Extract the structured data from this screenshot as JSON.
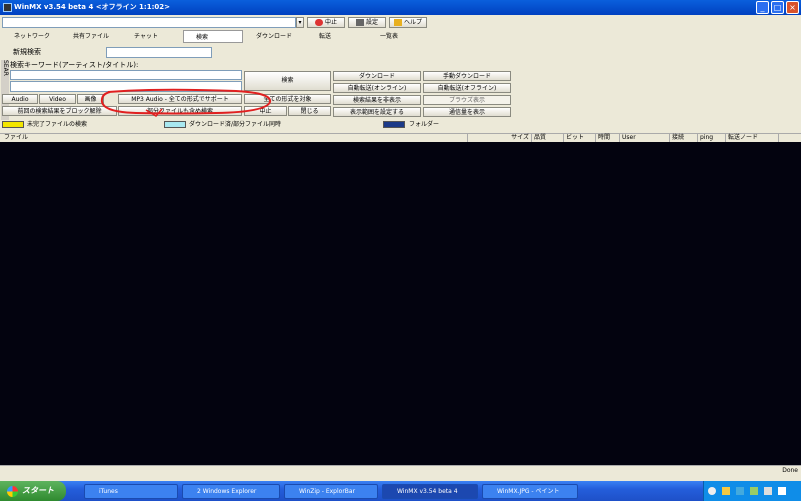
{
  "window": {
    "title": "WinMX v3.54 beta 4 <オフライン 1:1:02>"
  },
  "toolbar1": {
    "stop": "中止",
    "settings": "設定",
    "help": "ヘルプ"
  },
  "tabs": [
    {
      "label": "ネットワーク"
    },
    {
      "label": "共有ファイル"
    },
    {
      "label": "チャット"
    },
    {
      "label": "検索"
    },
    {
      "label": "ダウンロード"
    },
    {
      "label": "転送"
    },
    {
      "label": "一覧表"
    }
  ],
  "search": {
    "new_search": "新規検索",
    "keyword_label": "検索キーワード(アーティスト/タイトル):",
    "search_button": "検索",
    "side_label": "SEAR"
  },
  "filters": {
    "audio": "Audio",
    "video": "Video",
    "image": "画像",
    "mp3": "MP3 Audio - 全ての形式でサポート",
    "all": "全ての形式を対象",
    "partial": "部分ファイルも含め検索",
    "stop": "中止",
    "close": "閉じる",
    "prev_result": "前回の検索結果をブロック解除"
  },
  "right_buttons": [
    "ダウンロード",
    "手動ダウンロード",
    "自動転送(オンライン)",
    "自動転送(オフライン)",
    "検索結果を非表示",
    "ブラウズ表示",
    "表示範囲を設定する",
    "通信量を表示"
  ],
  "legend": {
    "item1": "未完了ファイルの検索",
    "item2": "ダウンロード済/部分ファイル同時",
    "item3": "フォルダー"
  },
  "columns": [
    "ファイル",
    "サイズ",
    "品質",
    "ビット",
    "時間",
    "User",
    "接続",
    "ping",
    "転送ノード"
  ],
  "status": {
    "right": "Done"
  },
  "taskbar": {
    "start": "スタート",
    "items": [
      "iTunes",
      "2 Windows Explorer",
      "WinZip - ExplorBar",
      "WinMX v3.54 beta 4",
      "WinMX.JPG - ペイント"
    ]
  },
  "annotation_color": "#e02020"
}
